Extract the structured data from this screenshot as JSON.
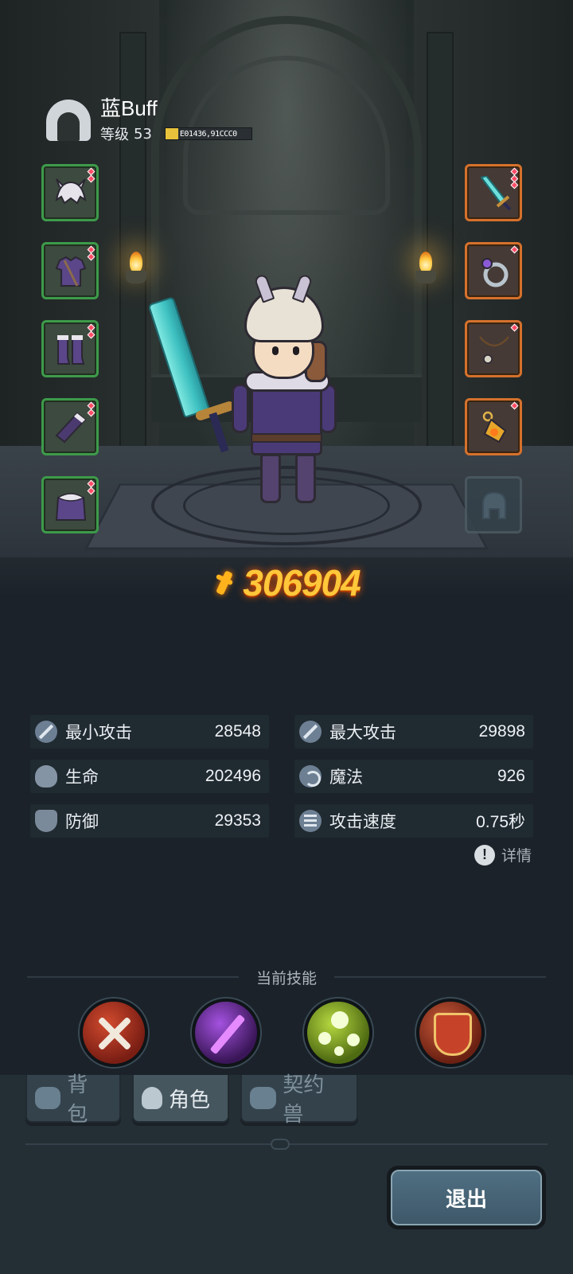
{
  "player": {
    "name": "蓝Buff",
    "level_label": "等级",
    "level": "53",
    "exp_text": "E01436,91CCC0",
    "exp_fraction": 0.15
  },
  "equipment": {
    "left": [
      "helmet-icon",
      "armor-icon",
      "boots-icon",
      "gloves-icon",
      "cape-icon"
    ],
    "right": [
      "sword-icon",
      "ring-icon",
      "necklace-icon",
      "amulet-icon",
      "mount-icon"
    ]
  },
  "combat_power": "306904",
  "stats": [
    {
      "label": "最小攻击",
      "value": "28548",
      "icon": "min-attack-icon"
    },
    {
      "label": "最大攻击",
      "value": "29898",
      "icon": "max-attack-icon"
    },
    {
      "label": "生命",
      "value": "202496",
      "icon": "health-icon"
    },
    {
      "label": "魔法",
      "value": "926",
      "icon": "magic-icon"
    },
    {
      "label": "防御",
      "value": "29353",
      "icon": "defense-icon"
    },
    {
      "label": "攻击速度",
      "value": "0.75秒",
      "icon": "attack-speed-icon"
    }
  ],
  "details_label": "详情",
  "skills": {
    "title": "当前技能",
    "items": [
      "crossed-axes-skill-icon",
      "purple-blade-skill-icon",
      "green-orbs-skill-icon",
      "shield-crest-skill-icon"
    ]
  },
  "tabs": [
    {
      "label": "背包",
      "icon": "bag-icon",
      "active": false
    },
    {
      "label": "角色",
      "icon": "character-icon",
      "active": true
    },
    {
      "label": "契约兽",
      "icon": "paw-icon",
      "active": false
    }
  ],
  "exit_label": "退出",
  "colors": {
    "power_gold": "#ffc73a",
    "slot_green": "#3d9a4a",
    "slot_orange": "#d5712c",
    "background": "#1b2229"
  }
}
